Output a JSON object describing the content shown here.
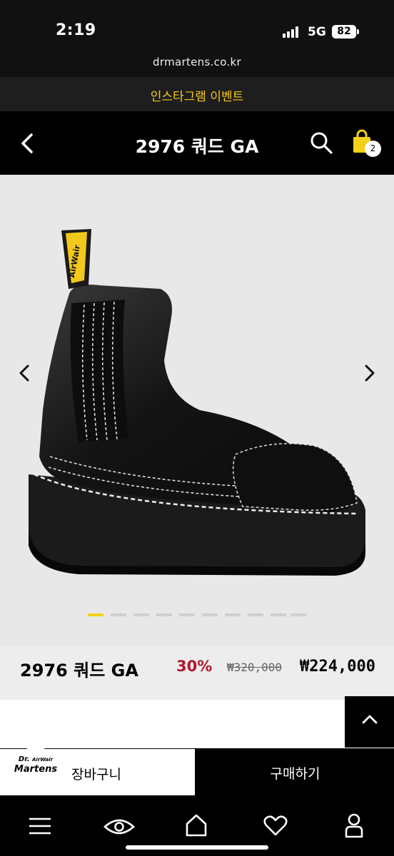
{
  "status_bar": {
    "time": "2:19",
    "network": "5G",
    "battery": "82"
  },
  "browser": {
    "url": "drmartens.co.kr"
  },
  "promo": {
    "text": "인스타그램 이벤트"
  },
  "header": {
    "title": "2976 쿼드 GA",
    "cart_count": "2"
  },
  "gallery": {
    "slide_count": 10,
    "active_slide": 1,
    "label_text": "AirWair"
  },
  "product": {
    "name": "2976 쿼드 GA",
    "discount": "30%",
    "original_price": "₩320,000",
    "sale_price": "₩224,000"
  },
  "actions": {
    "cart_label": "장바구니",
    "buy_label": "구매하기",
    "logo_line1": "Dr.",
    "logo_line2": "Martens",
    "logo_small": "AirWair"
  },
  "bottom_nav": {
    "items": [
      "menu-icon",
      "eye-icon",
      "home-icon",
      "heart-icon",
      "user-icon"
    ]
  },
  "colors": {
    "accent_yellow": "#F2D118",
    "discount_red": "#B0172C"
  }
}
